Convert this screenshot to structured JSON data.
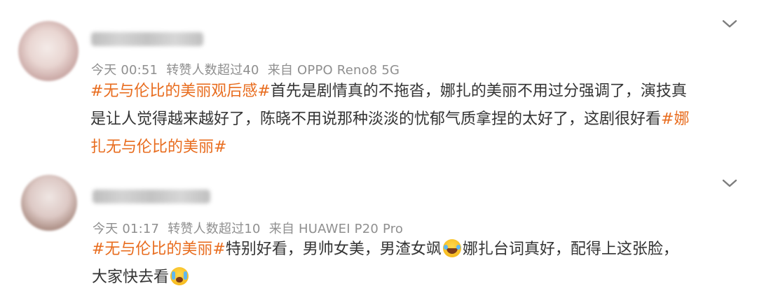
{
  "posts": [
    {
      "meta": {
        "time": "今天 00:51",
        "reposts": "转赞人数超过40",
        "source": "来自 OPPO Reno8 5G"
      },
      "lines": [
        [
          "#无与伦比的美丽观后感#",
          "首先是剧情真的不拖沓，娜扎的美丽不用过分强调了，演技真"
        ],
        [
          "是让人觉得越来越好了，陈晓不用说那种淡淡的忧郁气质拿捏的太好了，这剧很好看",
          "#娜"
        ],
        [
          "扎无与伦比的美丽#"
        ]
      ]
    },
    {
      "meta": {
        "time": "今天 01:17",
        "reposts": "转赞人数超过10",
        "source": "来自 HUAWEI P20 Pro"
      },
      "lines": [
        [
          "#无与伦比的美丽#",
          "特别好看，男帅女美，男渣女飒",
          "娜扎台词真好，配得上这张脸，"
        ],
        [
          "大家快去看"
        ]
      ],
      "emojis": [
        "laughing-crying-emoji",
        "teary-emoji"
      ]
    }
  ],
  "colors": {
    "hashtag": "#e86c1e",
    "meta": "#8f8f8f",
    "body": "#333333"
  },
  "icons": [
    "chevron-down-icon"
  ]
}
